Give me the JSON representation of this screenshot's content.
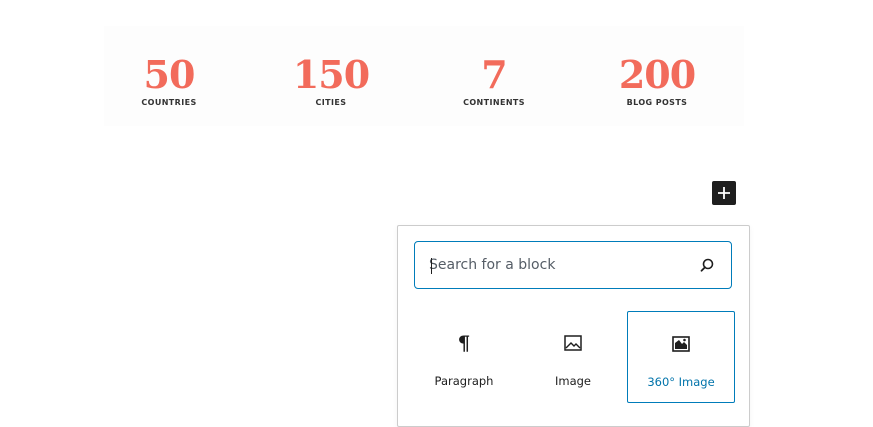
{
  "stats": [
    {
      "number": "50",
      "label": "COUNTRIES"
    },
    {
      "number": "150",
      "label": "CITIES"
    },
    {
      "number": "7",
      "label": "CONTINENTS"
    },
    {
      "number": "200",
      "label": "BLOG POSTS"
    }
  ],
  "inserter": {
    "toggle_icon": "plus-icon",
    "search": {
      "placeholder": "Search for a block",
      "value": "",
      "icon": "search-icon"
    },
    "blocks": [
      {
        "label": "Paragraph",
        "icon": "pilcrow-icon",
        "selected": false
      },
      {
        "label": "Image",
        "icon": "image-icon",
        "selected": false
      },
      {
        "label": "360° Image",
        "icon": "panorama-image-icon",
        "selected": true
      }
    ]
  },
  "colors": {
    "stat_number": "#f26b5b",
    "accent": "#007cba",
    "toggle_bg": "#1e1e1e"
  }
}
